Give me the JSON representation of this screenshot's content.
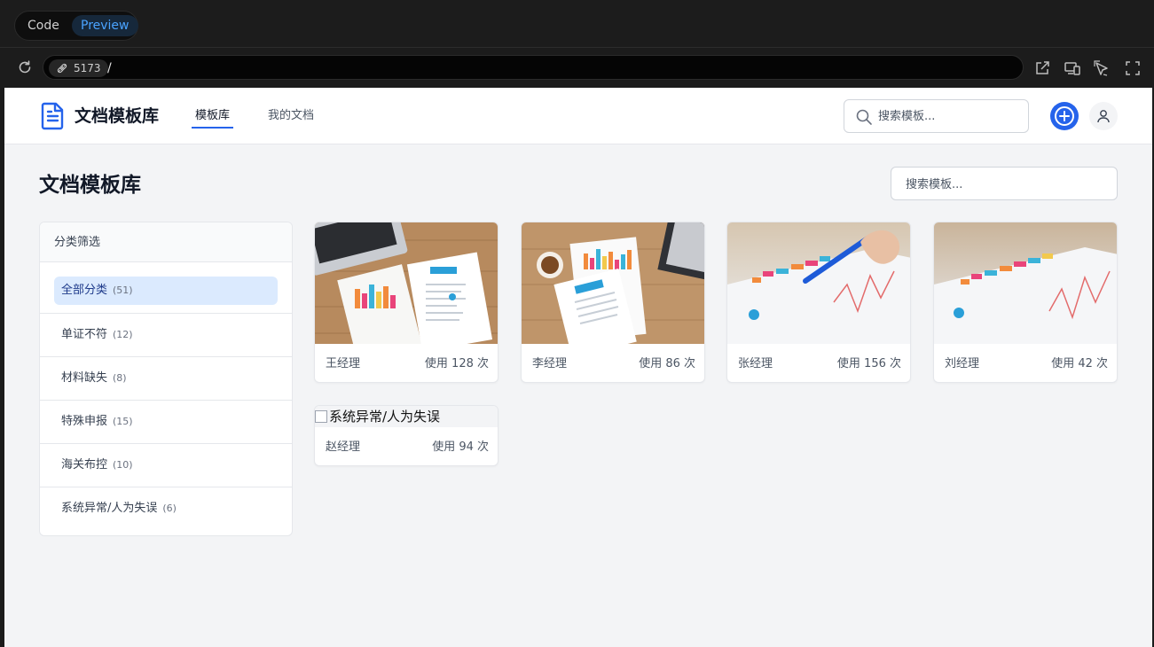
{
  "shell": {
    "tab_code": "Code",
    "tab_preview": "Preview",
    "port": "5173",
    "path": "/"
  },
  "app": {
    "brand": "文档模板库",
    "nav": [
      {
        "label": "模板库",
        "active": true
      },
      {
        "label": "我的文档",
        "active": false
      }
    ],
    "nav_search_placeholder": "搜索模板...",
    "page_title": "文档模板库",
    "main_search_placeholder": "搜索模板...",
    "accent_color": "#2563eb"
  },
  "sidebar": {
    "title": "分类筛选",
    "categories": [
      {
        "name": "全部分类",
        "count": "(51)",
        "selected": true
      },
      {
        "name": "单证不符",
        "count": "(12)"
      },
      {
        "name": "材料缺失",
        "count": "(8)"
      },
      {
        "name": "特殊申报",
        "count": "(15)"
      },
      {
        "name": "海关布控",
        "count": "(10)"
      },
      {
        "name": "系统异常/人为失误",
        "count": "(6)"
      }
    ]
  },
  "cards": [
    {
      "owner": "王经理",
      "uses": "使用 128 次",
      "image": "laptop-charts-photo"
    },
    {
      "owner": "李经理",
      "uses": "使用 86 次",
      "image": "coffee-charts-photo"
    },
    {
      "owner": "张经理",
      "uses": "使用 156 次",
      "image": "pen-chart-photo"
    },
    {
      "owner": "刘经理",
      "uses": "使用 42 次",
      "image": "chart-paper-photo"
    },
    {
      "owner": "赵经理",
      "uses": "使用 94 次",
      "image_alt": "系统异常/人为失误",
      "image_broken": true
    }
  ]
}
